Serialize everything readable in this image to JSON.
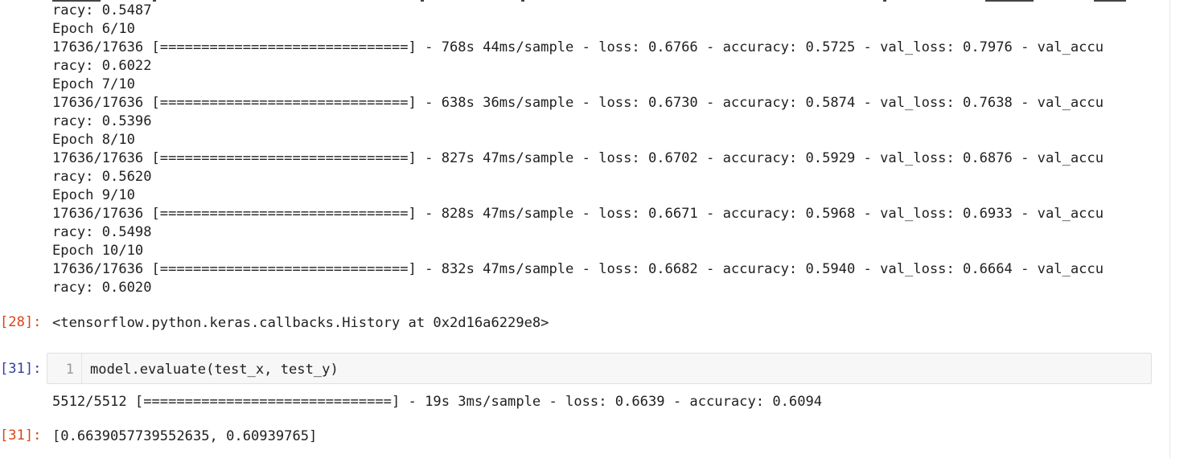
{
  "notebook": {
    "training_output_lines": [
      "racy: 0.5487",
      "Epoch 6/10",
      "17636/17636 [==============================] - 768s 44ms/sample - loss: 0.6766 - accuracy: 0.5725 - val_loss: 0.7976 - val_accu",
      "racy: 0.6022",
      "Epoch 7/10",
      "17636/17636 [==============================] - 638s 36ms/sample - loss: 0.6730 - accuracy: 0.5874 - val_loss: 0.7638 - val_accu",
      "racy: 0.5396",
      "Epoch 8/10",
      "17636/17636 [==============================] - 827s 47ms/sample - loss: 0.6702 - accuracy: 0.5929 - val_loss: 0.6876 - val_accu",
      "racy: 0.5620",
      "Epoch 9/10",
      "17636/17636 [==============================] - 828s 47ms/sample - loss: 0.6671 - accuracy: 0.5968 - val_loss: 0.6933 - val_accu",
      "racy: 0.5498",
      "Epoch 10/10",
      "17636/17636 [==============================] - 832s 47ms/sample - loss: 0.6682 - accuracy: 0.5940 - val_loss: 0.6664 - val_accu",
      "racy: 0.6020"
    ],
    "cell_28": {
      "out_prompt": "[28]:",
      "out_text": "<tensorflow.python.keras.callbacks.History at 0x2d16a6229e8>"
    },
    "cell_31": {
      "in_prompt": "[31]:",
      "line_number": "1",
      "code": "model.evaluate(test_x, test_y)",
      "stream_text": "5512/5512 [==============================] - 19s 3ms/sample - loss: 0.6639 - accuracy: 0.6094",
      "out_prompt": "[31]:",
      "out_text": "[0.6639057739552635, 0.60939765]"
    }
  },
  "colors": {
    "out_prompt": "#d84315",
    "in_prompt": "#303f9f",
    "text": "#212121",
    "input_bg": "#f7f7f7"
  }
}
